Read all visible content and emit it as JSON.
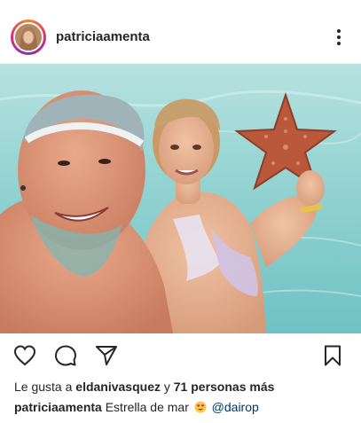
{
  "post": {
    "username": "patriciaamenta",
    "caption_username": "patriciaamenta",
    "caption_text": "Estrella de mar",
    "caption_emoji": "heart-eyes-emoji",
    "caption_mention": "@dairop"
  },
  "likes": {
    "prefix": "Le gusta a",
    "liked_by": "eldanivasquez",
    "connector": "y",
    "others": "71 personas más"
  },
  "icons": {
    "more": "more-vertical-icon",
    "like": "heart-icon",
    "comment": "comment-icon",
    "share": "send-icon",
    "save": "bookmark-icon"
  },
  "colors": {
    "text": "#262626",
    "mention": "#00376b",
    "sea": "#8fd1cf",
    "avatar_ring_start": "#f58529",
    "avatar_ring_end": "#dd2a7b"
  }
}
